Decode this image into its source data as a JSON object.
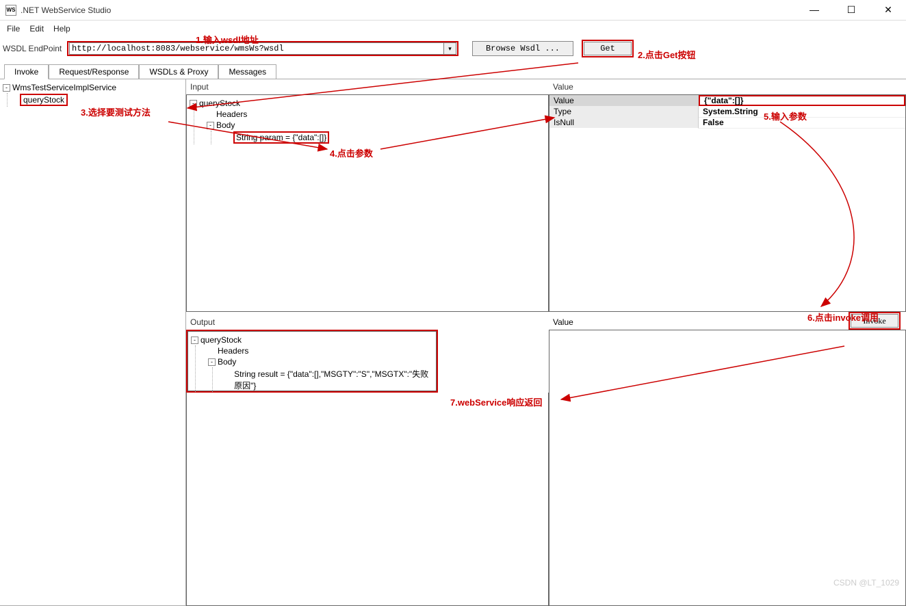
{
  "window": {
    "title": ".NET WebService Studio",
    "icon_label": "WS"
  },
  "menu": {
    "file": "File",
    "edit": "Edit",
    "help": "Help"
  },
  "endpoint": {
    "label": "WSDL EndPoint",
    "value": "http://localhost:8083/webservice/wmsWs?wsdl",
    "browse": "Browse Wsdl ...",
    "get": "Get"
  },
  "tabs": {
    "invoke": "Invoke",
    "reqres": "Request/Response",
    "wsdls": "WSDLs & Proxy",
    "messages": "Messages"
  },
  "left_tree": {
    "root": "WmsTestServiceImplService",
    "method": "queryStock"
  },
  "input_panel": {
    "header": "Input",
    "root": "queryStock",
    "headers": "Headers",
    "body": "Body",
    "param": "String param = {\"data\":[]}"
  },
  "value_panel": {
    "header": "Value",
    "rows": {
      "value_k": "Value",
      "value_v": "{\"data\":[]}",
      "type_k": "Type",
      "type_v": "System.String",
      "isnull_k": "IsNull",
      "isnull_v": "False"
    }
  },
  "output_panel": {
    "header": "Output",
    "root": "queryStock",
    "headers": "Headers",
    "body": "Body",
    "result": "String result = {\"data\":[],\"MSGTY\":\"S\",\"MSGTX\":\"失败原因\"}"
  },
  "value_lower_header": "Value",
  "invoke_btn": "Invoke",
  "annotations": {
    "a1": "1.输入wsdl地址",
    "a2": "2.点击Get按钮",
    "a3": "3.选择要测试方法",
    "a4": "4.点击参数",
    "a5": "5.输入参数",
    "a6": "6.点击invoke调用",
    "a7": "7.webService响应返回"
  },
  "watermark": "CSDN @LT_1029"
}
